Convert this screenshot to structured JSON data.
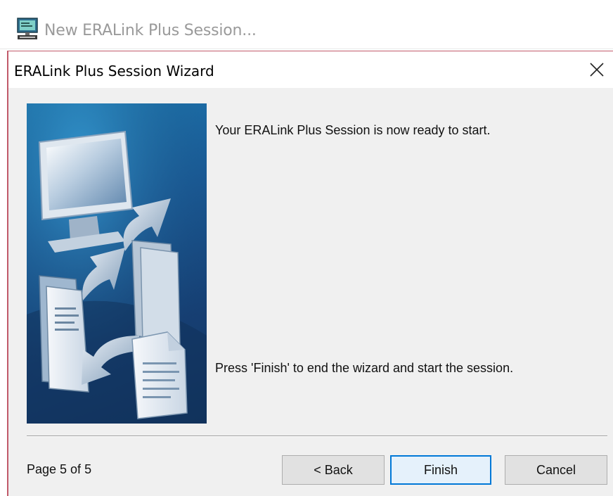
{
  "outer_window": {
    "title": "New ERALink Plus Session...",
    "icon": "terminal-computer-icon"
  },
  "dialog": {
    "title": "ERALink Plus Session Wizard",
    "close_icon": "close-icon",
    "image": "wizard-transfer-illustration",
    "message_top": "Your ERALink Plus Session is now ready to start.",
    "message_bottom": "Press 'Finish' to end the wizard and start the session.",
    "page_indicator": "Page 5 of 5",
    "buttons": {
      "back": "< Back",
      "finish": "Finish",
      "cancel": "Cancel"
    }
  },
  "colors": {
    "dialog_border": "#c15a6a",
    "default_button_border": "#0078d7",
    "image_blue": "#1a5c98"
  }
}
